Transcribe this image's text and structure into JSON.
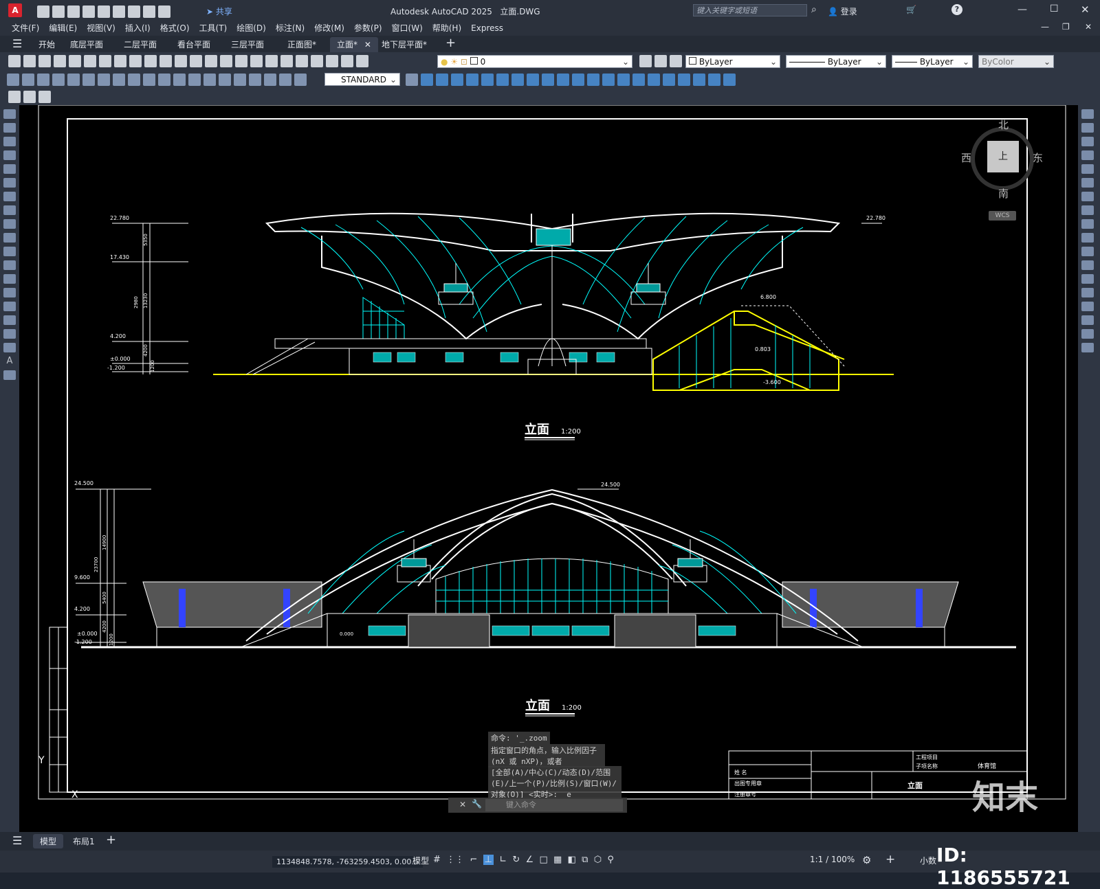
{
  "titlebar": {
    "app_title": "Autodesk AutoCAD 2025",
    "file_name": "立面.DWG",
    "share_label": "共享",
    "search_placeholder": "键入关键字或短语",
    "login_label": "登录"
  },
  "menu": [
    "文件(F)",
    "编辑(E)",
    "视图(V)",
    "插入(I)",
    "格式(O)",
    "工具(T)",
    "绘图(D)",
    "标注(N)",
    "修改(M)",
    "参数(P)",
    "窗口(W)",
    "帮助(H)",
    "Express"
  ],
  "doc_tabs": [
    "开始",
    "底层平面",
    "二层平面",
    "看台平面",
    "三层平面",
    "正面图*",
    "立面*",
    "地下层平面*"
  ],
  "active_tab": "立面*",
  "properties": {
    "layer": "0",
    "color": "ByLayer",
    "linetype": "ByLayer",
    "lineweight": "ByLayer",
    "plotstyle": "ByColor",
    "textstyle": "STANDARD"
  },
  "viewcube": {
    "north": "北",
    "south": "南",
    "east": "东",
    "west": "西",
    "face": "上",
    "wcs": "WCS"
  },
  "drawing": {
    "elev1": {
      "title": "立面",
      "scale": "1:200",
      "levels": [
        "22.780",
        "17.430",
        "4.200",
        "±0.000",
        "-1.200"
      ],
      "dims": [
        "5350",
        "2980",
        "13230",
        "4200",
        "1200"
      ],
      "right_level": "22.780",
      "section_levels": [
        "6.800",
        "0.803",
        "-3.600"
      ]
    },
    "elev2": {
      "title": "立面",
      "scale": "1:200",
      "levels": [
        "24.500",
        "9.600",
        "4.200",
        "±0.000",
        "-1.200"
      ],
      "dims": [
        "14900",
        "23700",
        "5400",
        "4200",
        "1200"
      ],
      "top_level": "24.500",
      "floor_level": "0.000"
    },
    "titleblock": {
      "project_label": "工程项目",
      "subproject_label": "子项名称",
      "subproject": "体育馆",
      "drawing_name": "立面",
      "rows": [
        "姓 名",
        "出图专用章",
        "注册章号"
      ]
    }
  },
  "command": {
    "history1": "命令: '_.zoom",
    "history2": "指定窗口的角点，输入比例因子 (nX 或 nXP)，或者",
    "history3": "[全部(A)/中心(C)/动态(D)/范围(E)/上一个(P)/比例(S)/窗口(W)/对象(O)] <实时>: _e",
    "prompt_placeholder": "键入命令"
  },
  "layout_tabs": [
    "模型",
    "布局1"
  ],
  "status": {
    "coords": "1134848.7578, -763259.4503, 0.00...",
    "model": "模型",
    "scale": "1:1 / 100%",
    "units": "小数"
  },
  "watermark": {
    "id": "ID: 1186555721",
    "brand": "知末"
  }
}
